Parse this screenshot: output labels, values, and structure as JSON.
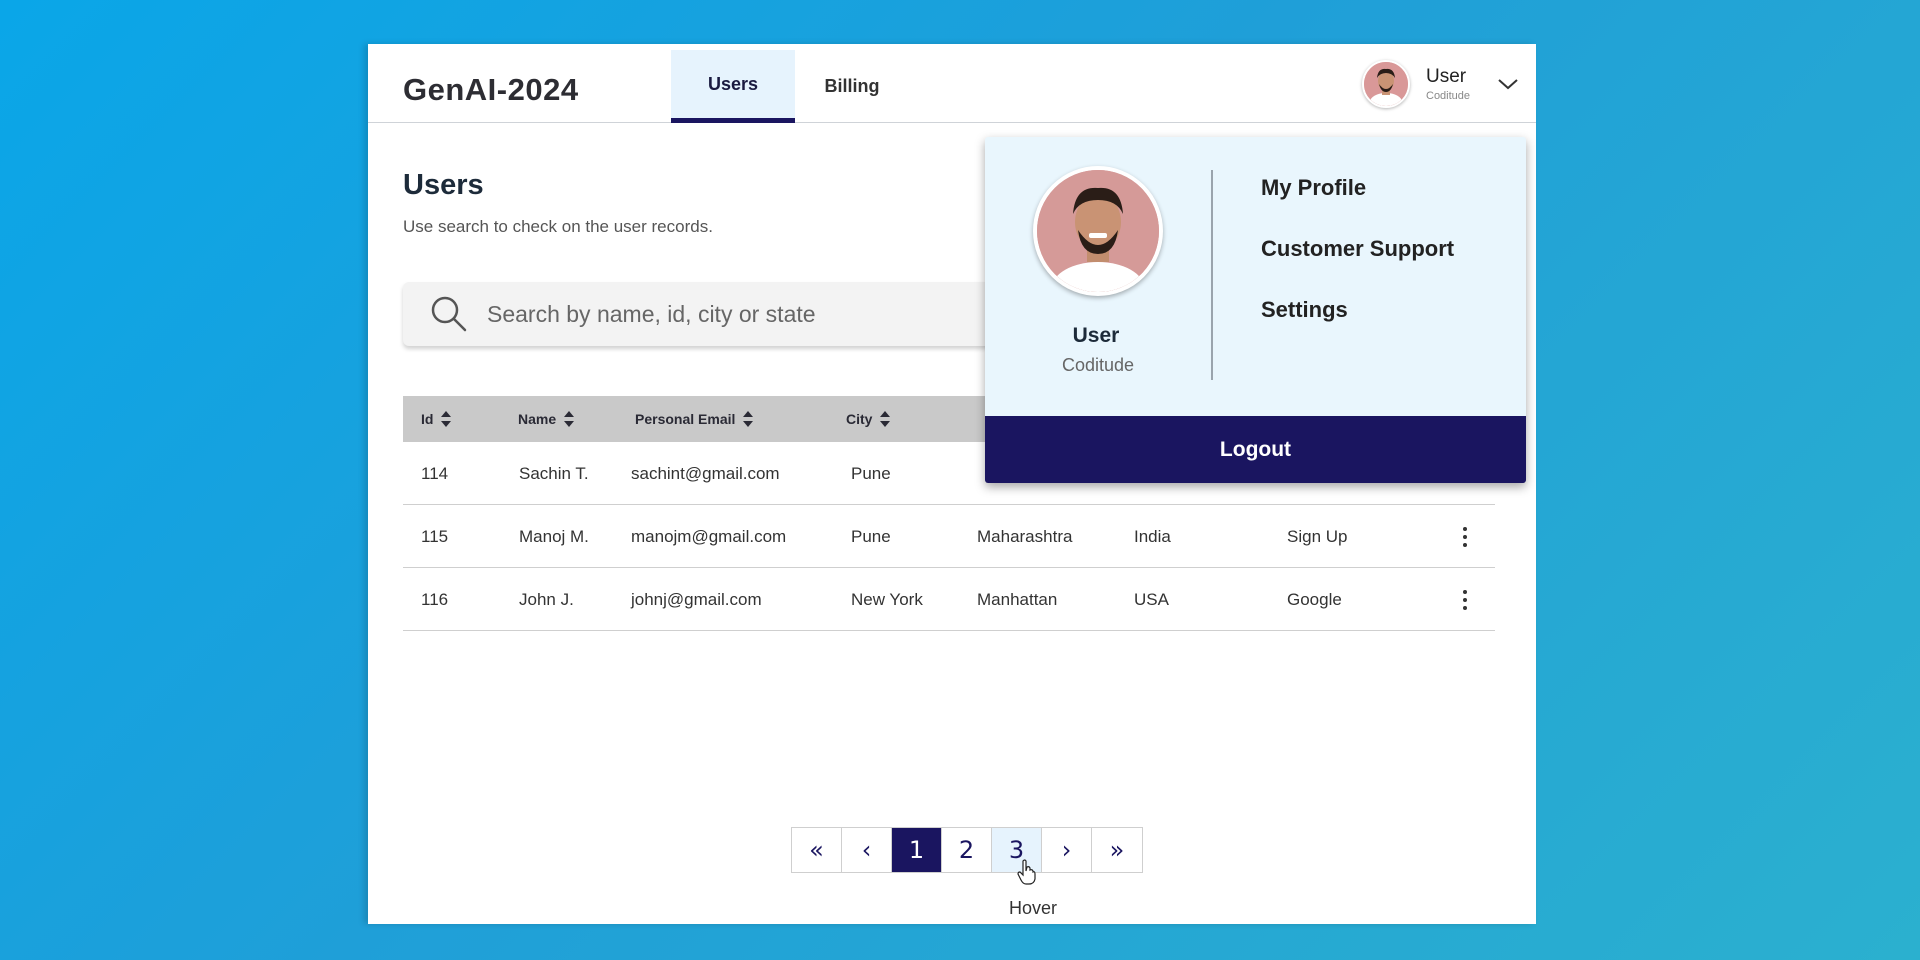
{
  "header": {
    "brand": "GenAI-2024",
    "tabs": [
      {
        "label": "Users",
        "active": true
      },
      {
        "label": "Billing",
        "active": false
      }
    ],
    "user": {
      "name": "User",
      "org": "Coditude"
    }
  },
  "main": {
    "title": "Users",
    "subtitle": "Use search to check on the user records.",
    "search": {
      "placeholder": "Search by name, id, city or state",
      "value": ""
    }
  },
  "table": {
    "columns": [
      "Id",
      "Name",
      "Personal Email",
      "City"
    ],
    "rows": [
      {
        "id": "114",
        "name": "Sachin T.",
        "email": "sachint@gmail.com",
        "city": "Pune",
        "state": "",
        "country": "",
        "source": ""
      },
      {
        "id": "115",
        "name": "Manoj M.",
        "email": "manojm@gmail.com",
        "city": "Pune",
        "state": "Maharashtra",
        "country": "India",
        "source": "Sign Up"
      },
      {
        "id": "116",
        "name": "John J.",
        "email": "johnj@gmail.com",
        "city": "New York",
        "state": "Manhattan",
        "country": "USA",
        "source": "Google"
      }
    ]
  },
  "pagination": {
    "first": "«",
    "prev": "‹",
    "next": "›",
    "last": "»",
    "pages": [
      "1",
      "2",
      "3"
    ],
    "active": "1",
    "hovered": "3",
    "caption": "Hover"
  },
  "dropdown": {
    "name": "User",
    "org": "Coditude",
    "items": [
      "My Profile",
      "Customer Support",
      "Settings"
    ],
    "logout": "Logout"
  },
  "colors": {
    "accent": "#1a1560",
    "active_tab_bg": "#e6f3fd",
    "dropdown_bg": "#e9f6fd"
  }
}
